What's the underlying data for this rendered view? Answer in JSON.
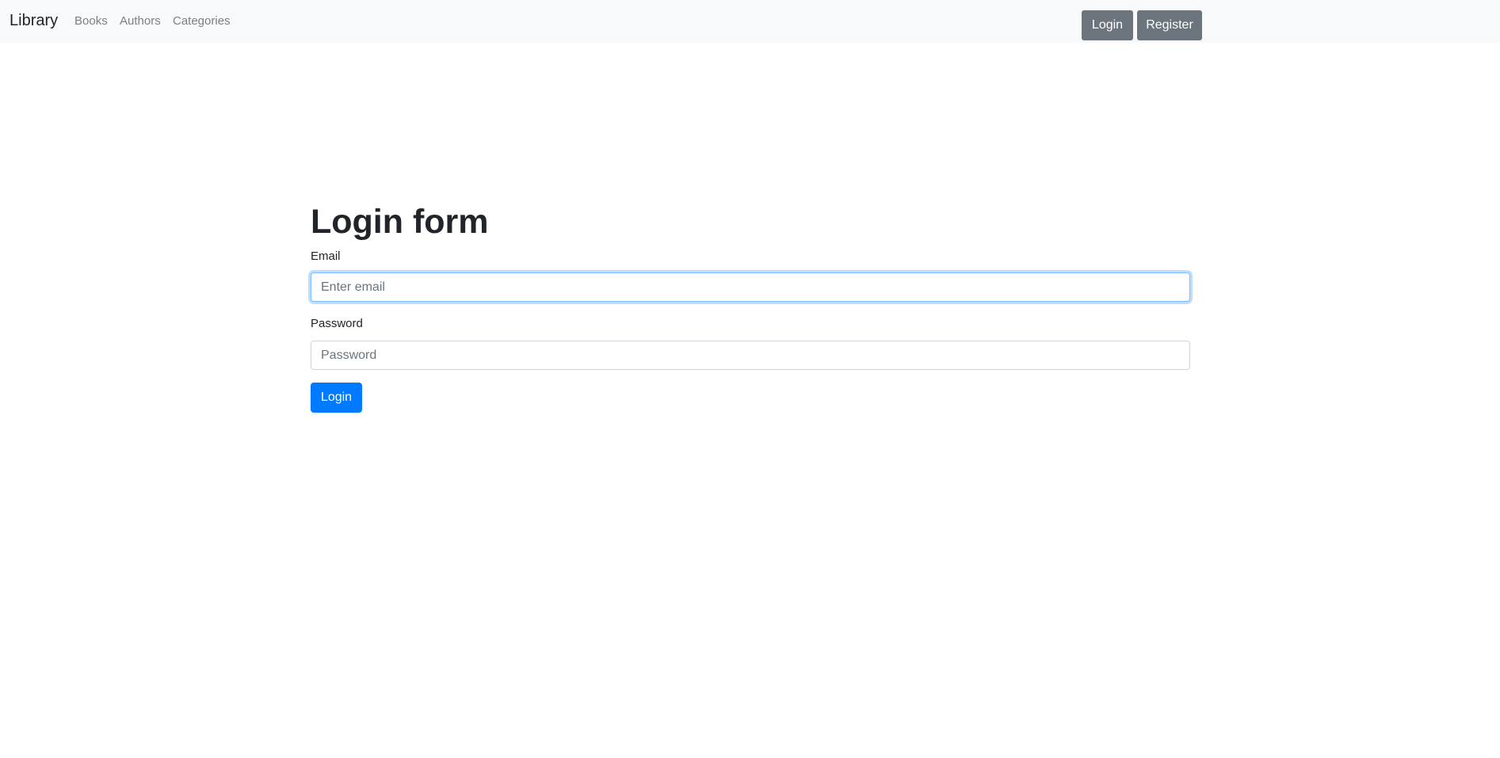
{
  "navbar": {
    "brand": "Library",
    "links": [
      "Books",
      "Authors",
      "Categories"
    ],
    "login_label": "Login",
    "register_label": "Register"
  },
  "form": {
    "title": "Login form",
    "email_label": "Email",
    "email_placeholder": "Enter email",
    "email_value": "",
    "password_label": "Password",
    "password_placeholder": "Password",
    "password_value": "",
    "submit_label": "Login"
  },
  "colors": {
    "primary": "#007bff",
    "secondary": "#6c757d",
    "navbar_bg": "#f8f9fa"
  }
}
